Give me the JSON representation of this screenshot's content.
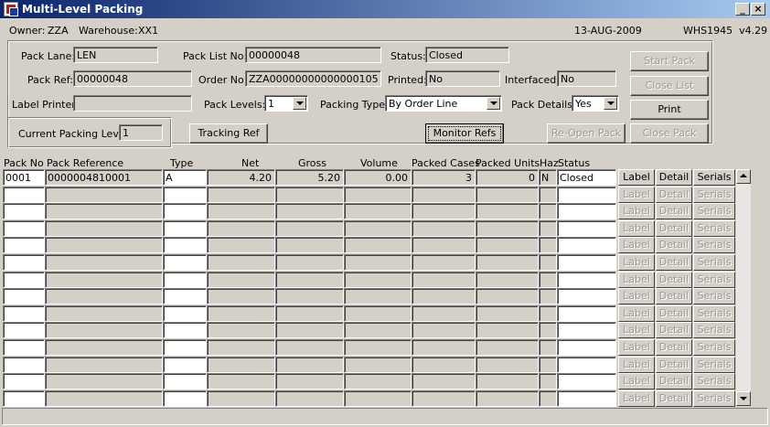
{
  "window": {
    "title": "Multi-Level Packing",
    "icon": "oracle-forms-icon",
    "min_glyph": "_",
    "close_glyph": "×"
  },
  "info": {
    "owner_label": "Owner:",
    "owner": "ZZA",
    "warehouse_label": "Warehouse:",
    "warehouse": "XX1",
    "date": "13-AUG-2009",
    "version": "WHS1945  v4.29"
  },
  "form": {
    "pack_lane_label": "Pack Lane:",
    "pack_lane": "LEN",
    "pack_list_no_label": "Pack List No:",
    "pack_list_no": "00000048",
    "status_label": "Status:",
    "status": "Closed",
    "pack_ref_label": "Pack Ref:",
    "pack_ref": "00000048",
    "order_no_label": "Order No:",
    "order_no": "ZZA00000000000000105",
    "printed_label": "Printed:",
    "printed": "No",
    "interfaced_label": "Interfaced:",
    "interfaced": "No",
    "label_printer_label": "Label Printer:",
    "label_printer": "",
    "pack_levels_label": "Pack Levels:",
    "pack_levels": "1",
    "packing_type_label": "Packing Type:",
    "packing_type": "By Order Line",
    "pack_details_label": "Pack Details:",
    "pack_details": "Yes",
    "current_level_label": "Current Packing Level",
    "current_level": "1"
  },
  "buttons": {
    "start_pack": "Start Pack",
    "close_list": "Close List",
    "print": "Print",
    "tracking_ref": "Tracking Ref",
    "monitor_refs": "Monitor Refs",
    "reopen_pack": "Re-Open Pack",
    "close_pack": "Close Pack"
  },
  "grid": {
    "headers": {
      "pack_no": "Pack No",
      "pack_reference": "Pack Reference",
      "type": "Type",
      "net": "Net",
      "gross": "Gross",
      "volume": "Volume",
      "packed_cases": "Packed Cases",
      "packed_units": "Packed Units",
      "haz": "Haz",
      "status": "Status"
    },
    "rows": [
      {
        "pack_no": "0001",
        "pack_reference": "0000004810001",
        "type": "A",
        "net": "4.20",
        "gross": "5.20",
        "volume": "0.00",
        "packed_cases": "3",
        "packed_units": "0",
        "haz": "N",
        "status": "Closed"
      }
    ],
    "empty_row_count": 13,
    "row_buttons": {
      "label": "Label",
      "detail": "Detail",
      "serials": "Serials"
    }
  }
}
